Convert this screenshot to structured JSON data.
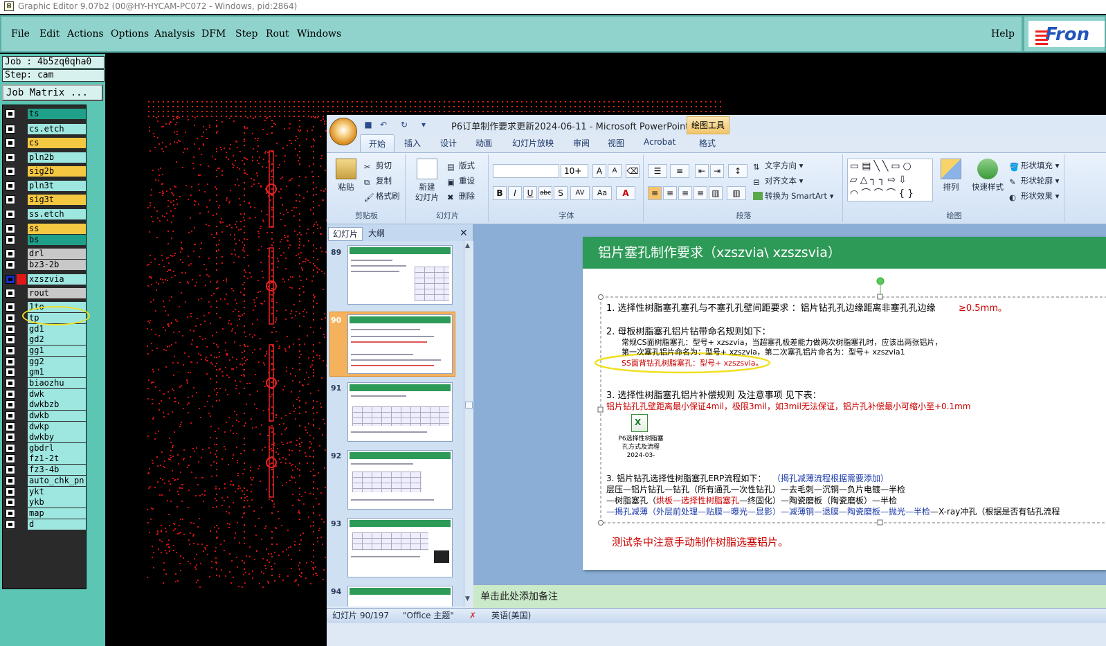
{
  "window": {
    "title": "Graphic Editor 9.07b2 (00@HY-HYCAM-PC072 - Windows, pid:2864)"
  },
  "menu": {
    "items": [
      "File",
      "Edit",
      "Actions",
      "Options",
      "Analysis",
      "DFM",
      "Step",
      "Rout",
      "Windows"
    ],
    "help": "Help",
    "logo": "Fron"
  },
  "job": {
    "job_label": "Job : 4b5zq0qha0",
    "step_label": "Step: cam",
    "matrix_button": "Job Matrix ..."
  },
  "layers": [
    {
      "name": "ts",
      "color": "#1fa08a"
    },
    {
      "name": "cs.etch",
      "color": "#9ee6e0"
    },
    {
      "name": "cs",
      "color": "#f5c842"
    },
    {
      "name": "pln2b",
      "color": "#9ee6e0"
    },
    {
      "name": "sig2b",
      "color": "#f5c842"
    },
    {
      "name": "pln3t",
      "color": "#9ee6e0"
    },
    {
      "name": "sig3t",
      "color": "#f5c842"
    },
    {
      "name": "ss.etch",
      "color": "#9ee6e0"
    },
    {
      "name": "ss",
      "color": "#f5c842"
    },
    {
      "name": "bs",
      "color": "#1fa08a"
    },
    {
      "name": "drl",
      "color": "#c8c8c8"
    },
    {
      "name": "bz3-2b",
      "color": "#c8c8c8"
    },
    {
      "name": "xzszvia",
      "color": "#9ee6e0"
    },
    {
      "name": "rout",
      "color": "#c8c8c8"
    },
    {
      "name": "1to",
      "color": "#9ee6e0"
    },
    {
      "name": "tp",
      "color": "#9ee6e0"
    },
    {
      "name": "gd1",
      "color": "#9ee6e0"
    },
    {
      "name": "gd2",
      "color": "#9ee6e0"
    },
    {
      "name": "gg1",
      "color": "#9ee6e0"
    },
    {
      "name": "gg2",
      "color": "#9ee6e0"
    },
    {
      "name": "gm1",
      "color": "#9ee6e0"
    },
    {
      "name": "biaozhu",
      "color": "#9ee6e0"
    },
    {
      "name": "dwk",
      "color": "#9ee6e0"
    },
    {
      "name": "dwkbzb",
      "color": "#9ee6e0"
    },
    {
      "name": "dwkb",
      "color": "#9ee6e0"
    },
    {
      "name": "dwkp",
      "color": "#9ee6e0"
    },
    {
      "name": "dwkby",
      "color": "#9ee6e0"
    },
    {
      "name": "gbdrl",
      "color": "#9ee6e0"
    },
    {
      "name": "fz1-2t",
      "color": "#9ee6e0"
    },
    {
      "name": "fz3-4b",
      "color": "#9ee6e0"
    },
    {
      "name": "auto_chk_pn",
      "color": "#9ee6e0"
    },
    {
      "name": "ykt",
      "color": "#9ee6e0"
    },
    {
      "name": "ykb",
      "color": "#9ee6e0"
    },
    {
      "name": "map",
      "color": "#9ee6e0"
    },
    {
      "name": "d",
      "color": "#9ee6e0"
    }
  ],
  "ppt": {
    "title": "P6订单制作要求更新2024-06-11 - Microsoft PowerPoint",
    "drawing_tools": "绘图工具",
    "tabs": [
      "开始",
      "插入",
      "设计",
      "动画",
      "幻灯片放映",
      "审阅",
      "视图",
      "Acrobat",
      "格式"
    ],
    "ribbon": {
      "clipboard": {
        "label": "剪贴板",
        "paste": "粘贴",
        "cut": "剪切",
        "copy": "复制",
        "format_painter": "格式刷"
      },
      "slides": {
        "label": "幻灯片",
        "new_slide": "新建\n幻灯片",
        "layout": "版式",
        "reset": "重设",
        "delete": "删除"
      },
      "font": {
        "label": "字体",
        "size": "10+"
      },
      "paragraph": {
        "label": "段落",
        "text_direction": "文字方向",
        "align_text": "对齐文本",
        "smartart": "转换为 SmartArt"
      },
      "drawing": {
        "label": "绘图",
        "arrange": "排列",
        "quick_styles": "快速样式",
        "shape_fill": "形状填充",
        "shape_outline": "形状轮廓",
        "shape_effects": "形状效果"
      }
    },
    "panel_tabs": [
      "幻灯片",
      "大纲"
    ],
    "thumbnails": [
      "89",
      "90",
      "91",
      "92",
      "93",
      "94"
    ],
    "slide": {
      "title": "铝片塞孔制作要求（xzszvia\\ xzszsvia）",
      "item1": "1.  选择性树脂塞孔塞孔与不塞孔孔壁间距要求 ：铝片钻孔孔边缘距离非塞孔孔边缘",
      "item1_value": "≥0.5mm。",
      "item2": "2.  母板树脂塞孔铝片钻带命名规则如下：",
      "item2_line1": "常规CS面树脂塞孔：型号+ xzszvia，当超塞孔极差能力做两次树脂塞孔时，应该出两张铝片，",
      "item2_line2": "第一次塞孔铝片命名为：型号+ xzszvia，第二次塞孔铝片命名为：型号+ xzszvia1",
      "item2_line3": "SS面背钻孔树脂塞孔：型号+ xzszsvia。",
      "item3": "3.  选择性树脂塞孔铝片补偿规则 及注意事项 见下表：",
      "item3_line1": "铝片钻孔孔壁距离最小保证4mil，极限3mil，如3mil无法保证，铝片孔补偿最小可缩小至+0.1mm",
      "embedded_file": "P6选择性树脂塞\n孔方式及流程2024-03-",
      "item4": "3.  铝片钻孔选择性树脂塞孔ERP流程如下：",
      "item4_note": "（揭孔减薄流程根据需要添加）",
      "item4_line1": "层压—铝片钻孔—钻孔（所有通孔一次性钻孔）—去毛刺—沉铜—负片电镀—半检",
      "item4_line2a": "—树脂塞孔（",
      "item4_line2b": "烘板—选择性树脂塞孔",
      "item4_line2c": "—终固化）—陶瓷磨板（陶瓷磨板）—半检",
      "item4_line3a": "—揭孔减薄（外层前处理—贴膜—曝光—显影）—减薄铜—退膜—陶瓷磨板—抛光—半检",
      "item4_line3b": "—X-ray冲孔（根据是否有钻孔流程",
      "footer_note": "测试条中注意手动制作树脂选塞铝片。"
    },
    "notes": "单击此处添加备注",
    "status": {
      "slide": "幻灯片 90/197",
      "theme": "\"Office 主题\"",
      "language": "英语(美国)"
    }
  }
}
